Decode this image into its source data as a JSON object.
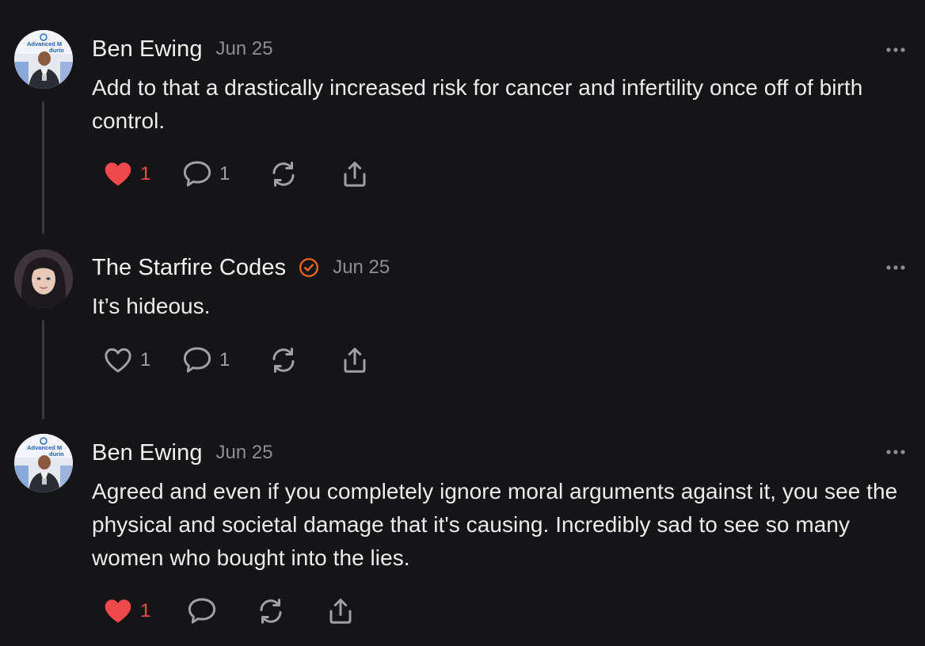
{
  "colors": {
    "background": "#151517",
    "liked_red": "#f0494b",
    "verified_orange": "#ff6b1a",
    "muted_text": "#8e8e93"
  },
  "posts": [
    {
      "author": "Ben Ewing",
      "date": "Jun 25",
      "verified": false,
      "text": "Add to that a drastically increased risk for cancer and infertility once off of birth control.",
      "liked": true,
      "like_count": "1",
      "comment_count": "1",
      "avatar_text": [
        "Advanced M",
        "durin"
      ]
    },
    {
      "author": "The Starfire Codes",
      "date": "Jun 25",
      "verified": true,
      "text": "It’s hideous.",
      "liked": false,
      "like_count": "1",
      "comment_count": "1"
    },
    {
      "author": "Ben Ewing",
      "date": "Jun 25",
      "verified": false,
      "text": "Agreed and even if you completely ignore moral arguments against it, you see the physical and societal damage that it's causing. Incredibly sad to see so many women who bought into the lies.",
      "liked": true,
      "like_count": "1",
      "comment_count": "",
      "avatar_text": [
        "Advanced M",
        "durin"
      ]
    }
  ],
  "icons": {
    "more": "ellipsis-icon",
    "like": "heart-icon",
    "comment": "comment-bubble-icon",
    "restack": "restack-icon",
    "share": "share-icon",
    "verified": "verified-badge-icon"
  }
}
